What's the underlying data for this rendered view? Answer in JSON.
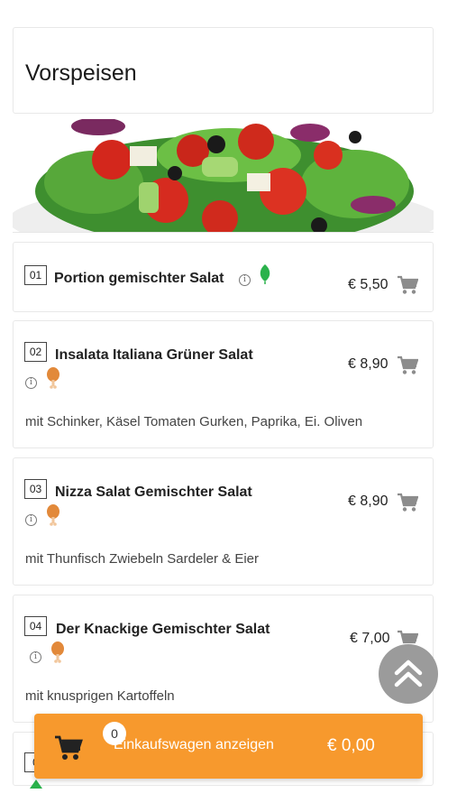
{
  "category": {
    "title": "Vorspeisen"
  },
  "items": [
    {
      "number": "01",
      "name": "Portion gemischter Salat",
      "price": "€ 5,50",
      "description": ""
    },
    {
      "number": "02",
      "name": "Insalata Italiana Grüner Salat",
      "price": "€ 8,90",
      "description": "mit Schinker, Käsel Tomaten Gurken, Paprika, Ei. Oliven"
    },
    {
      "number": "03",
      "name": "Nizza Salat Gemischter Salat",
      "price": "€ 8,90",
      "description": "mit Thunfisch Zwiebeln Sardeler & Eier"
    },
    {
      "number": "04",
      "name": "Der Knackige Gemischter Salat",
      "price": "€ 7,00",
      "description": "mit knusprigen Kartoffeln"
    },
    {
      "number": "0"
    }
  ],
  "icons": {
    "info": "i",
    "cart": "shopping-cart-icon",
    "vegetarian": "leaf-icon",
    "meat": "chicken-leg-icon",
    "scroll_top": "double-chevron-up-icon"
  },
  "cart": {
    "count": "0",
    "label": "Einkaufswagen anzeigen",
    "total": "€ 0,00"
  },
  "colors": {
    "accent": "#f7992d",
    "leaf": "#2bb24c",
    "chicken": "#e2893a",
    "fab": "#9b9b9b"
  }
}
